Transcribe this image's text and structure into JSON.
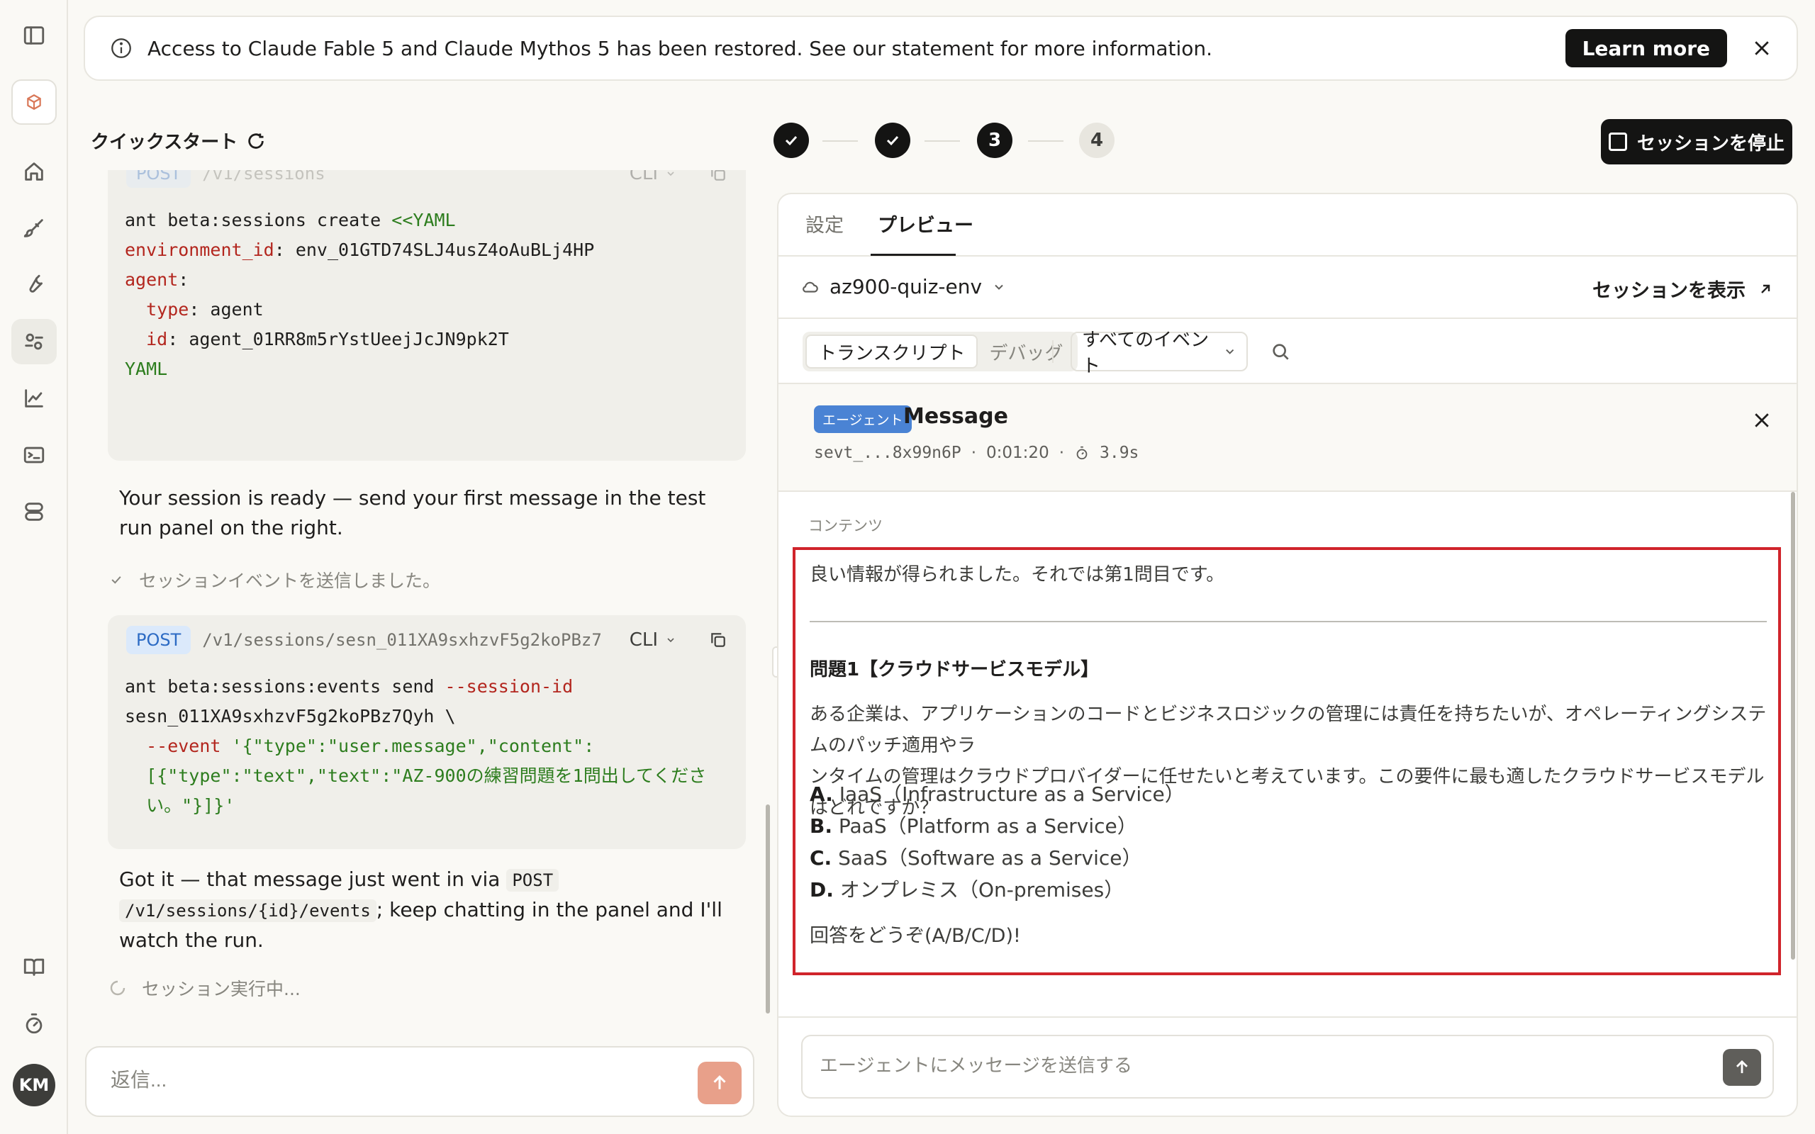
{
  "banner": {
    "text": "Access to Claude Fable 5 and Claude Mythos 5 has been restored. See our statement for more information.",
    "learn_more": "Learn more"
  },
  "left": {
    "title": "クイックスタート",
    "card1": {
      "method": "POST",
      "endpoint": "/v1/sessions",
      "mode": "CLI",
      "lines": [
        {
          "a": "ant beta:sessions create ",
          "b": "<<YAML"
        },
        {
          "a": "environment_id",
          "b": ": env_01GTD74SLJ4usZ4oAuBLj4HP"
        },
        {
          "a": "agent",
          "b": ":"
        },
        {
          "a": "  type",
          "b": ": agent"
        },
        {
          "a": "  id",
          "b": ": agent_01RR8m5rYstUeejJcJN9pk2T"
        },
        {
          "a": "YAML",
          "b": ""
        }
      ]
    },
    "ready_text": "Your session is ready — send your first message in the test run panel on the right.",
    "sent_status": "セッションイベントを送信しました。",
    "card2": {
      "method": "POST",
      "endpoint": "/v1/sessions/sesn_011XA9sxhzvF5g2koPBz7",
      "mode": "CLI",
      "line1a": "ant beta:sessions:events send ",
      "line1b": "--session-id",
      "line2": "sesn_011XA9sxhzvF5g2koPBz7Qyh \\",
      "line3a": "  --event ",
      "line3b": "'{\"type\":\"user.message\",\"content\":",
      "line4": "  [{\"type\":\"text\",\"text\":\"AZ-900の練習問題を1問出してくださ",
      "line5": "  い。\"}]}'"
    },
    "got_it_a": "Got it — that message just went in via ",
    "got_it_code1": "POST",
    "got_it_code2": "/v1/sessions/{id}/events",
    "got_it_b": "; keep chatting in the panel and I'll watch the run.",
    "running_status": "セッション実行中...",
    "reply_placeholder": "返信..."
  },
  "stepper": {
    "steps": [
      "✓",
      "✓",
      "3",
      "4"
    ],
    "stop_label": "セッションを停止"
  },
  "right": {
    "tabs": [
      "設定",
      "プレビュー"
    ],
    "env_name": "az900-quiz-env",
    "view_session": "セッションを表示",
    "seg": [
      "トランスクリプト",
      "デバッグ"
    ],
    "event_filter": "すべてのイベント",
    "message": {
      "badge": "エージェント",
      "title": "Message",
      "event_id": "sevt_...8x99n6P",
      "time": "0:01:20",
      "duration": "3.9s"
    },
    "content_label": "コンテンツ",
    "content": {
      "intro": "良い情報が得られました。それでは第1問目です。",
      "q_title": "問題1【クラウドサービスモデル】",
      "q_body1": "ある企業は、アプリケーションのコードとビジネスロジックの管理には責任を持ちたいが、オペレーティングシステムのパッチ適用やラ",
      "q_body2": "ンタイムの管理はクラウドプロバイダーに任せたいと考えています。この要件に最も適したクラウドサービスモデルはどれですか？",
      "options": [
        {
          "key": "A.",
          "text": " IaaS（Infrastructure as a Service）"
        },
        {
          "key": "B.",
          "text": " PaaS（Platform as a Service）"
        },
        {
          "key": "C.",
          "text": " SaaS（Software as a Service）"
        },
        {
          "key": "D.",
          "text": " オンプレミス（On-premises）"
        }
      ],
      "prompt": "回答をどうぞ(A/B/C/D)!"
    },
    "send_placeholder": "エージェントにメッセージを送信する"
  },
  "user": {
    "initials": "KM"
  },
  "colors": {
    "highlight": "#d0242b",
    "agent_badge": "#4a83d4",
    "reply_send": "#e8a08a"
  }
}
